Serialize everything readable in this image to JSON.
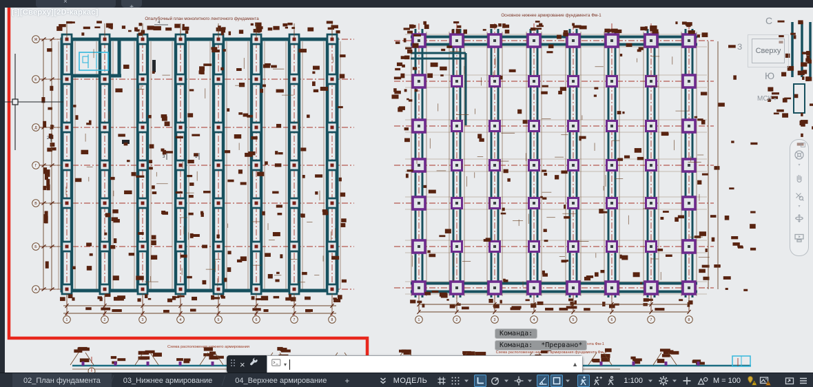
{
  "window": {
    "file_tab_close": "×",
    "file_tab_add": "+"
  },
  "viewport": {
    "controls_label": "[-][Сверху][2D-каркас]"
  },
  "viewcube": {
    "north": "С",
    "west": "З",
    "south": "Ю",
    "face": "Сверху",
    "wcs": "МСК"
  },
  "navbar": {
    "icons": [
      "navigation-wheel-icon",
      "pan-hand-icon",
      "zoom-icon",
      "orbit-icon",
      "showmotion-icon"
    ]
  },
  "command": {
    "history": [
      "Команда:",
      "Команда:  *Прервано*"
    ],
    "input_value": "",
    "close": "×",
    "expand": "▲",
    "dropdown": "▾"
  },
  "layout_tabs": {
    "tabs": [
      "02_План фундамента",
      "03_Нижнее армирование",
      "04_Верхнее армирование"
    ],
    "add_label": "+",
    "active_index": 0
  },
  "status_bar": {
    "items": [
      {
        "name": "collapse-chevrons-icon",
        "icon": "chevrons"
      },
      {
        "name": "model-button",
        "text": "МОДЕЛЬ",
        "cls": "model"
      },
      {
        "name": "grid-icon",
        "icon": "grid"
      },
      {
        "name": "snap-icon",
        "icon": "dots"
      },
      {
        "name": "snap-dropdown-icon",
        "icon": "caret"
      },
      {
        "name": "ortho-icon",
        "icon": "ortho",
        "hl": true,
        "gap": 5
      },
      {
        "name": "polar-tracking-icon",
        "icon": "polar",
        "gap": 3
      },
      {
        "name": "polar-dropdown-icon",
        "icon": "caret"
      },
      {
        "name": "osnap-tracking-icon",
        "icon": "otrack",
        "gap": 3
      },
      {
        "name": "osnap-tracking-dropdown-icon",
        "icon": "caret"
      },
      {
        "name": "isodraft-icon",
        "icon": "angle",
        "hl": true,
        "gap": 4
      },
      {
        "name": "osnap-icon",
        "icon": "square",
        "hl": true
      },
      {
        "name": "osnap-dropdown-icon",
        "icon": "caret"
      },
      {
        "name": "annotation-visibility-icon",
        "icon": "runner",
        "hl": true,
        "gap": 8
      },
      {
        "name": "annotation-autoscale-icon",
        "icon": "runner2"
      },
      {
        "name": "annotation-monitor-icon",
        "icon": "runner3"
      },
      {
        "name": "annotation-scale-button",
        "text": "1:100",
        "gap": 3
      },
      {
        "name": "scale-dropdown-icon",
        "icon": "caret"
      },
      {
        "name": "workspace-gear-icon",
        "icon": "gear",
        "gap": 4
      },
      {
        "name": "workspace-dropdown-icon",
        "icon": "caret"
      },
      {
        "name": "customization-plus-icon",
        "icon": "plus",
        "gap": 3
      },
      {
        "name": "annotation-scale-icon",
        "icon": "annoscale",
        "gap": 4
      },
      {
        "name": "annotation-scale-value",
        "text": "М = 100"
      },
      {
        "name": "geolocation-warning-icon",
        "icon": "geowarn",
        "gap": 2
      },
      {
        "name": "image-warning-icon",
        "icon": "imgwarn"
      },
      {
        "name": "clean-screen-icon",
        "icon": "cleanscreen",
        "gap": 16
      },
      {
        "name": "status-menu-icon",
        "icon": "menu"
      }
    ]
  },
  "drawing": {
    "left_plan": {
      "title": "Опалубочный план монолитного ленточного фундамента",
      "col_labels": [
        "1",
        "2",
        "3",
        "4",
        "5",
        "6",
        "7",
        "8"
      ],
      "row_labels": [
        "Ж",
        "Е",
        "Д",
        "Г",
        "В",
        "Б",
        "А"
      ],
      "detail_labels": [
        "4",
        "2",
        "3",
        "1"
      ]
    },
    "right_plan": {
      "title": "Основное нижнее армирование фундамента Фм-1",
      "col_labels": [
        "1",
        "2",
        "3",
        "4",
        "5",
        "6",
        "7",
        "8"
      ]
    },
    "bottom_section": {
      "title": "Схема расположения нижнего армирования",
      "title_full": "Схема расположения нижнего армирования фундамента Фм-1",
      "title_fragment": "фундамента Фм-1"
    },
    "colors": {
      "canvas": "#e9ebed",
      "wall_teal": "#17505e",
      "stirrup_purple": "#6e2b8e",
      "rebar_brown": "#582310",
      "axis_red": "#a63326",
      "dim_brown": "#6b4326",
      "selection_cyan": "#35b8dc",
      "boundary_red": "#e8271d"
    }
  }
}
